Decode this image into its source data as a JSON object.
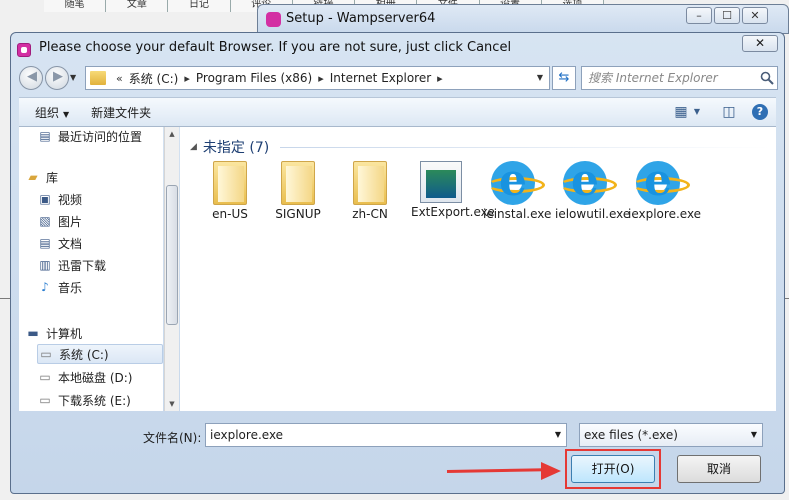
{
  "background": {
    "tabs": [
      "随笔",
      "文章",
      "日记",
      "评论",
      "链接",
      "相册",
      "文件",
      "设置",
      "选项"
    ]
  },
  "setup_window": {
    "title": "Setup - Wampserver64"
  },
  "dialog": {
    "title": "Please choose your default Browser. If you are not sure, just click Cancel",
    "close_label": "✕",
    "address": {
      "prefix": "«",
      "crumbs": [
        "系统 (C:)",
        "Program Files (x86)",
        "Internet Explorer"
      ]
    },
    "search_placeholder": "搜索 Internet Explorer",
    "toolbar": {
      "organize": "组织",
      "new_folder": "新建文件夹"
    },
    "nav": {
      "recent": "最近访问的位置",
      "library": "库",
      "video": "视频",
      "pictures": "图片",
      "documents": "文档",
      "xunlei": "迅雷下载",
      "music": "音乐",
      "computer": "计算机",
      "drive_c": "系统 (C:)",
      "drive_d": "本地磁盘 (D:)",
      "drive_e": "下载系统 (E:)"
    },
    "group_header": "未指定 (7)",
    "files": [
      {
        "name": "en-US",
        "kind": "folder"
      },
      {
        "name": "SIGNUP",
        "kind": "folder"
      },
      {
        "name": "zh-CN",
        "kind": "folder"
      },
      {
        "name": "ExtExport.exe",
        "kind": "exe"
      },
      {
        "name": "ieinstal.exe",
        "kind": "ie"
      },
      {
        "name": "ielowutil.exe",
        "kind": "ie"
      },
      {
        "name": "iexplore.exe",
        "kind": "ie"
      }
    ],
    "filename_label": "文件名(N):",
    "filename_value": "iexplore.exe",
    "filetype_value": "exe files (*.exe)",
    "open_button": "打开(O)",
    "cancel_button": "取消"
  },
  "colors": {
    "highlight": "#e53935",
    "title_icon": "#d32fa3"
  }
}
